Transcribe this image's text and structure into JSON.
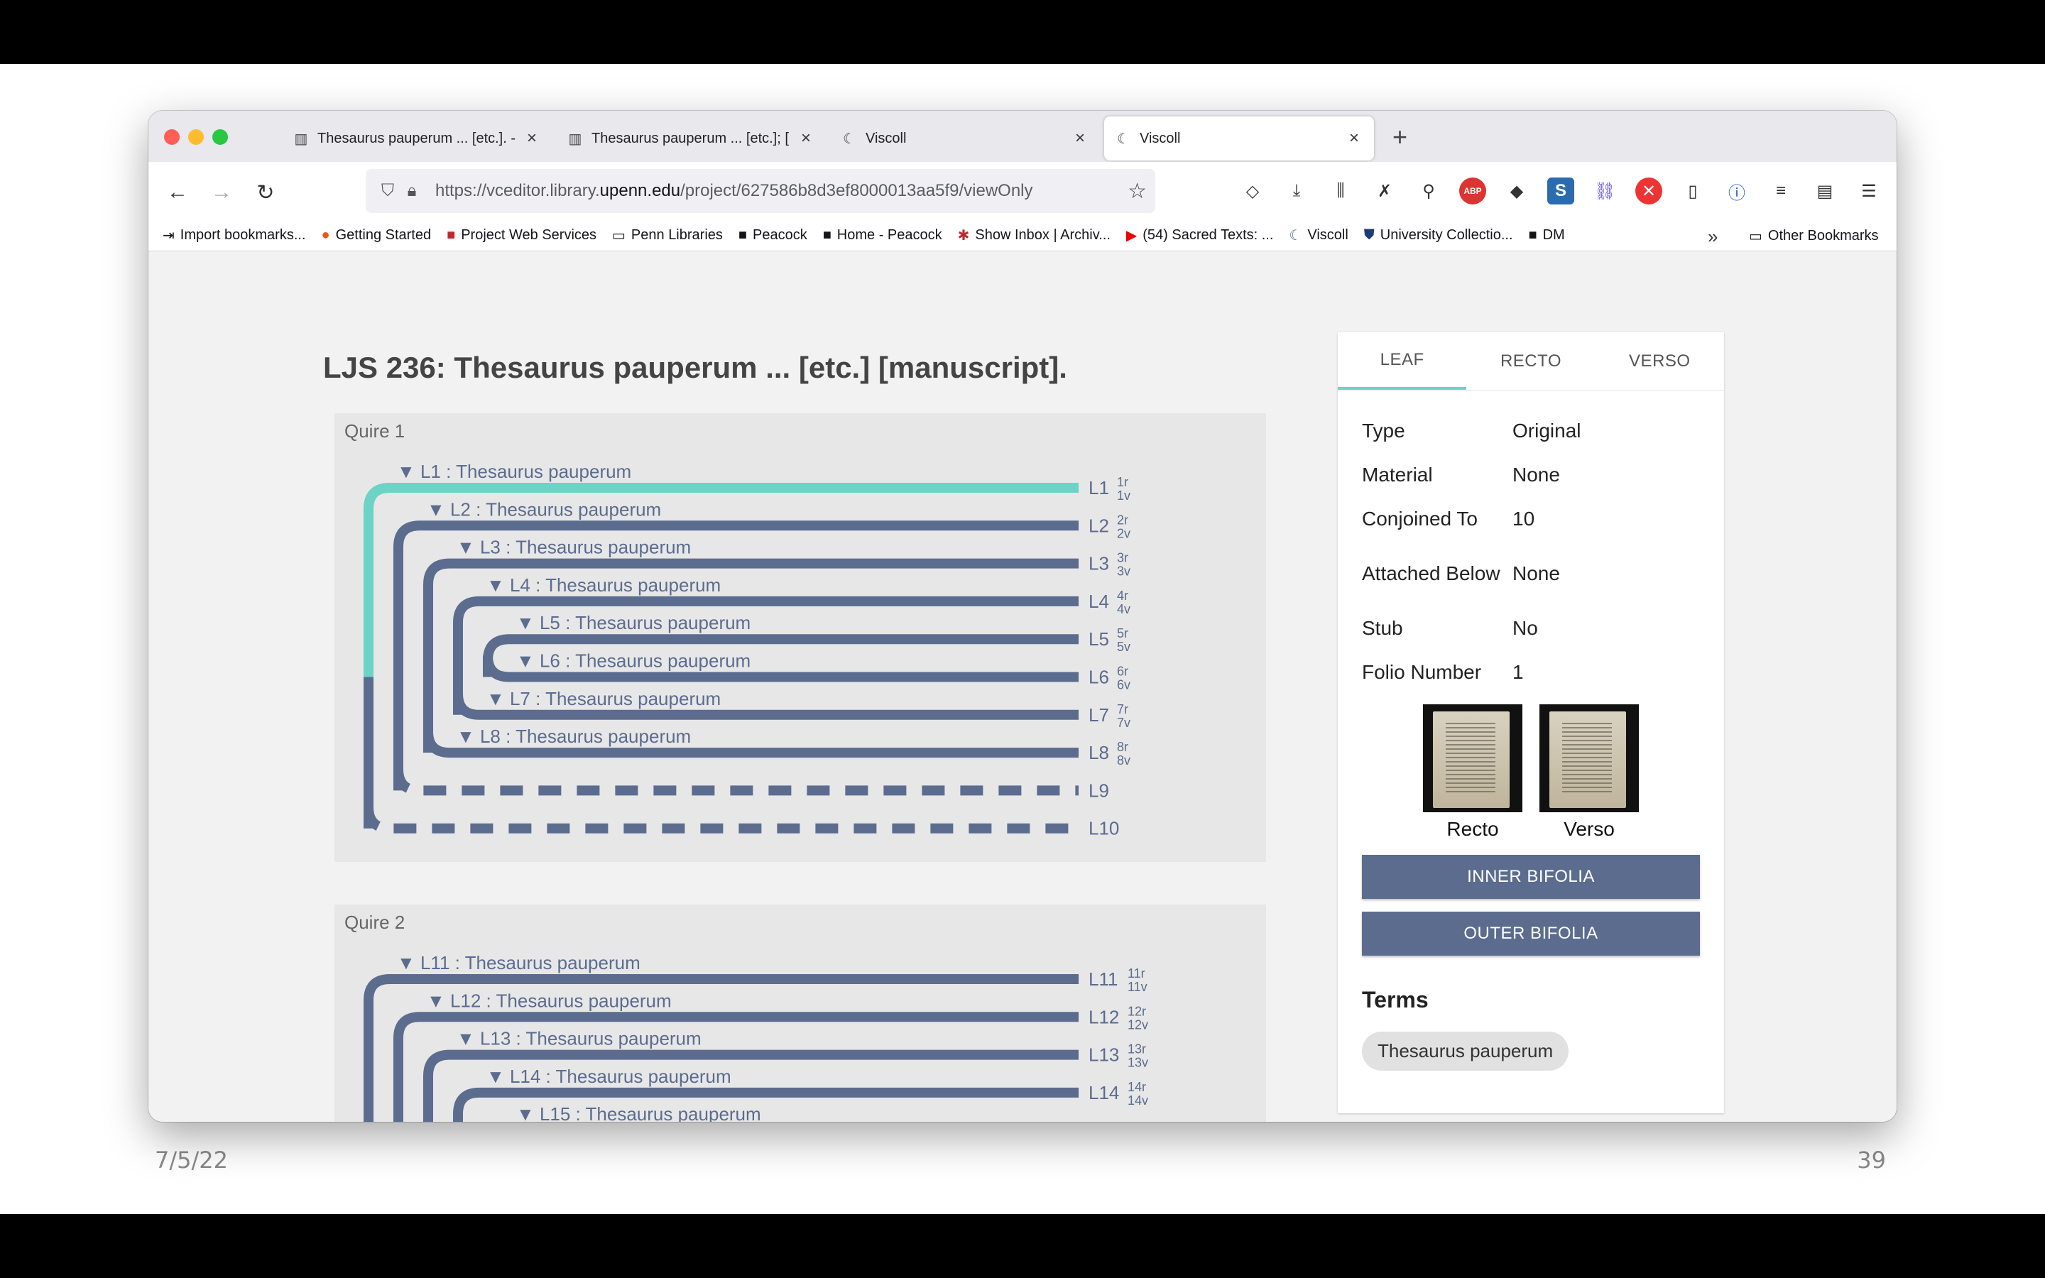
{
  "slide": {
    "date": "7/5/22",
    "number": "39"
  },
  "browser": {
    "tabs": [
      {
        "label": "Thesaurus pauperum ... [etc.]. -",
        "icon": "book-icon",
        "active": false
      },
      {
        "label": "Thesaurus pauperum ... [etc.]; [",
        "icon": "book-icon",
        "active": false
      },
      {
        "label": "Viscoll",
        "icon": "viscoll-icon",
        "active": false
      },
      {
        "label": "Viscoll",
        "icon": "viscoll-icon",
        "active": true
      }
    ],
    "url_prefix": "https://vceditor.library.",
    "url_domain": "upenn.edu",
    "url_suffix": "/project/627586b8d3ef8000013aa5f9/viewOnly",
    "bookmarks": [
      {
        "label": "Import bookmarks...",
        "icon": "import-icon"
      },
      {
        "label": "Getting Started",
        "icon": "firefox-icon"
      },
      {
        "label": "Project Web Services",
        "icon": "p-icon"
      },
      {
        "label": "Penn Libraries",
        "icon": "folder-icon"
      },
      {
        "label": "Peacock",
        "icon": "peacock-icon"
      },
      {
        "label": "Home - Peacock",
        "icon": "peacock-icon"
      },
      {
        "label": "Show Inbox | Archiv...",
        "icon": "archive-icon"
      },
      {
        "label": "(54) Sacred Texts: ...",
        "icon": "youtube-icon"
      },
      {
        "label": "Viscoll",
        "icon": "viscoll-icon"
      },
      {
        "label": "University Collectio...",
        "icon": "shield-icon"
      },
      {
        "label": "DM",
        "icon": "dm-icon"
      }
    ],
    "other_bookmarks": "Other Bookmarks"
  },
  "page": {
    "title": "LJS 236: Thesaurus pauperum ... [etc.] [manuscript]."
  },
  "quires": [
    {
      "label": "Quire 1",
      "leaves": [
        {
          "title": "▼ L1 : Thesaurus pauperum",
          "id": "L1",
          "recto": "1r",
          "verso": "1v",
          "dashed": false,
          "selected": true
        },
        {
          "title": "▼ L2 : Thesaurus pauperum",
          "id": "L2",
          "recto": "2r",
          "verso": "2v",
          "dashed": false
        },
        {
          "title": "▼ L3 : Thesaurus pauperum",
          "id": "L3",
          "recto": "3r",
          "verso": "3v",
          "dashed": false
        },
        {
          "title": "▼ L4 : Thesaurus pauperum",
          "id": "L4",
          "recto": "4r",
          "verso": "4v",
          "dashed": false
        },
        {
          "title": "▼ L5 : Thesaurus pauperum",
          "id": "L5",
          "recto": "5r",
          "verso": "5v",
          "dashed": false
        },
        {
          "title": "▼ L6 : Thesaurus pauperum",
          "id": "L6",
          "recto": "6r",
          "verso": "6v",
          "dashed": false
        },
        {
          "title": "▼ L7 : Thesaurus pauperum",
          "id": "L7",
          "recto": "7r",
          "verso": "7v",
          "dashed": false
        },
        {
          "title": "▼ L8 : Thesaurus pauperum",
          "id": "L8",
          "recto": "8r",
          "verso": "8v",
          "dashed": false
        },
        {
          "title": "",
          "id": "L9",
          "recto": "",
          "verso": "",
          "dashed": true
        },
        {
          "title": "",
          "id": "L10",
          "recto": "",
          "verso": "",
          "dashed": true
        }
      ]
    },
    {
      "label": "Quire 2",
      "leaves": [
        {
          "title": "▼ L11 : Thesaurus pauperum",
          "id": "L11",
          "recto": "11r",
          "verso": "11v",
          "dashed": false
        },
        {
          "title": "▼ L12 : Thesaurus pauperum",
          "id": "L12",
          "recto": "12r",
          "verso": "12v",
          "dashed": false
        },
        {
          "title": "▼ L13 : Thesaurus pauperum",
          "id": "L13",
          "recto": "13r",
          "verso": "13v",
          "dashed": false
        },
        {
          "title": "▼ L14 : Thesaurus pauperum",
          "id": "L14",
          "recto": "14r",
          "verso": "14v",
          "dashed": false
        },
        {
          "title": "▼ L15 : Thesaurus pauperum",
          "id": "L15",
          "recto": "",
          "verso": "",
          "dashed": false
        }
      ]
    }
  ],
  "panel": {
    "tabs": [
      "LEAF",
      "RECTO",
      "VERSO"
    ],
    "active_tab": "LEAF",
    "properties": [
      {
        "key": "Type",
        "value": "Original"
      },
      {
        "key": "Material",
        "value": "None"
      },
      {
        "key": "Conjoined To",
        "value": "10"
      },
      {
        "key": "Attached Below",
        "value": "None"
      },
      {
        "key": "Stub",
        "value": "No"
      },
      {
        "key": "Folio Number",
        "value": "1"
      }
    ],
    "thumbnails": [
      {
        "caption": "Recto"
      },
      {
        "caption": "Verso"
      }
    ],
    "buttons": {
      "inner": "INNER BIFOLIA",
      "outer": "OUTER BIFOLIA"
    },
    "terms_heading": "Terms",
    "terms": [
      "Thesaurus pauperum"
    ]
  },
  "colors": {
    "leaf": "#5b6c8f",
    "selected": "#6cd3c6",
    "quire_bg": "#e7e7e7"
  }
}
